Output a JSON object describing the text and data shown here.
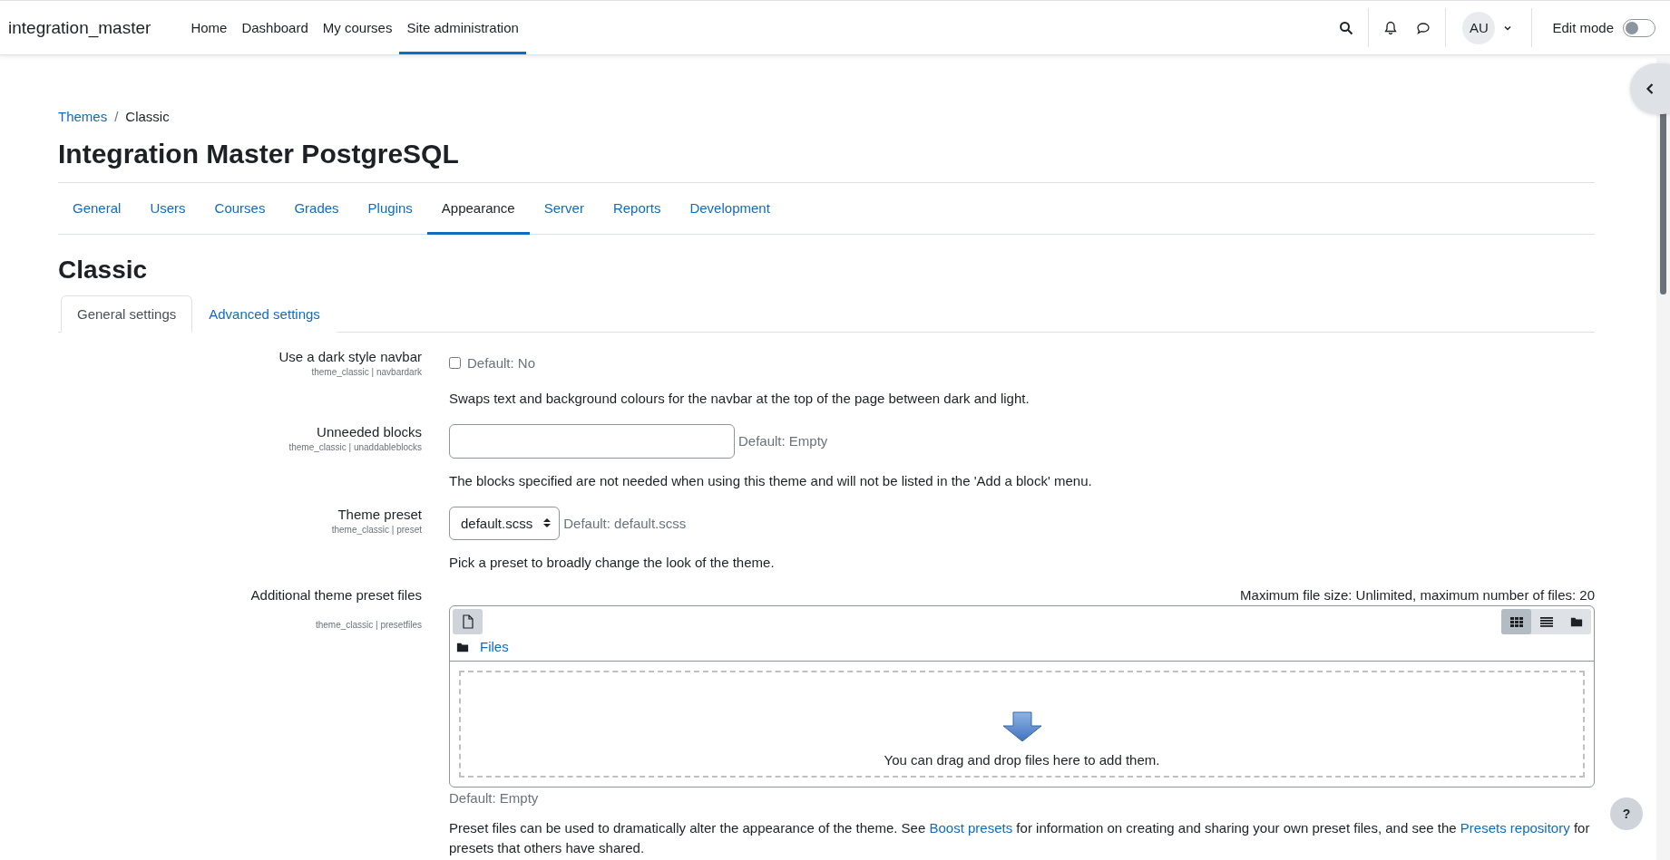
{
  "navbar": {
    "site_name": "integration_master",
    "links": [
      {
        "label": "Home",
        "selected": false
      },
      {
        "label": "Dashboard",
        "selected": false
      },
      {
        "label": "My courses",
        "selected": false
      },
      {
        "label": "Site administration",
        "selected": true
      }
    ],
    "avatar": "AU",
    "edit_mode": {
      "label": "Edit mode",
      "on": false
    }
  },
  "breadcrumb": [
    {
      "label": "Themes",
      "kind": "link"
    },
    {
      "label": "/",
      "kind": "separator"
    },
    {
      "label": "Classic",
      "kind": "current"
    }
  ],
  "page_title": "Integration Master PostgreSQL",
  "admin_tabs": [
    {
      "label": "General",
      "selected": false
    },
    {
      "label": "Users",
      "selected": false
    },
    {
      "label": "Courses",
      "selected": false
    },
    {
      "label": "Grades",
      "selected": false
    },
    {
      "label": "Plugins",
      "selected": false
    },
    {
      "label": "Appearance",
      "selected": true
    },
    {
      "label": "Server",
      "selected": false
    },
    {
      "label": "Reports",
      "selected": false
    },
    {
      "label": "Development",
      "selected": false
    }
  ],
  "section_title": "Classic",
  "settings_tabs": [
    {
      "label": "General settings",
      "selected": true
    },
    {
      "label": "Advanced settings",
      "selected": false
    }
  ],
  "settings": [
    {
      "kind": "checkbox",
      "label": "Use a dark style navbar",
      "setting_id": "theme_classic | navbardark",
      "checked": false,
      "default": "Default: No",
      "description": [
        {
          "kind": "text",
          "text": "Swaps text and background colours for the navbar at the top of the page between dark and light."
        }
      ]
    },
    {
      "kind": "text",
      "label": "Unneeded blocks",
      "setting_id": "theme_classic | unaddableblocks",
      "default": "Default: Empty",
      "description": [
        {
          "kind": "text",
          "text": "The blocks specified are not needed when using this theme and will not be listed in the 'Add a block' menu."
        }
      ]
    },
    {
      "kind": "select",
      "label": "Theme preset",
      "setting_id": "theme_classic | preset",
      "value": "default.scss",
      "default": "Default: default.scss",
      "description": [
        {
          "kind": "text",
          "text": "Pick a preset to broadly change the look of the theme."
        }
      ]
    },
    {
      "kind": "filemanager",
      "label": "Additional theme preset files",
      "setting_id": "theme_classic | presetfiles",
      "limits": "Maximum file size: Unlimited, maximum number of files: 20",
      "views": [
        {
          "kind": "grid",
          "selected": true
        },
        {
          "kind": "list",
          "selected": false
        },
        {
          "kind": "tree",
          "selected": false
        }
      ],
      "path": "Files",
      "drop_text": "You can drag and drop files here to add them.",
      "default": "Default: Empty",
      "description": [
        {
          "kind": "text",
          "text": "Preset files can be used to dramatically alter the appearance of the theme. See "
        },
        {
          "kind": "link",
          "text": "Boost presets"
        },
        {
          "kind": "text",
          "text": " for information on creating and sharing your own preset files, and see the "
        },
        {
          "kind": "link",
          "text": "Presets repository"
        },
        {
          "kind": "text",
          "text": " for presets that others have shared."
        }
      ]
    }
  ],
  "help_button": "?"
}
